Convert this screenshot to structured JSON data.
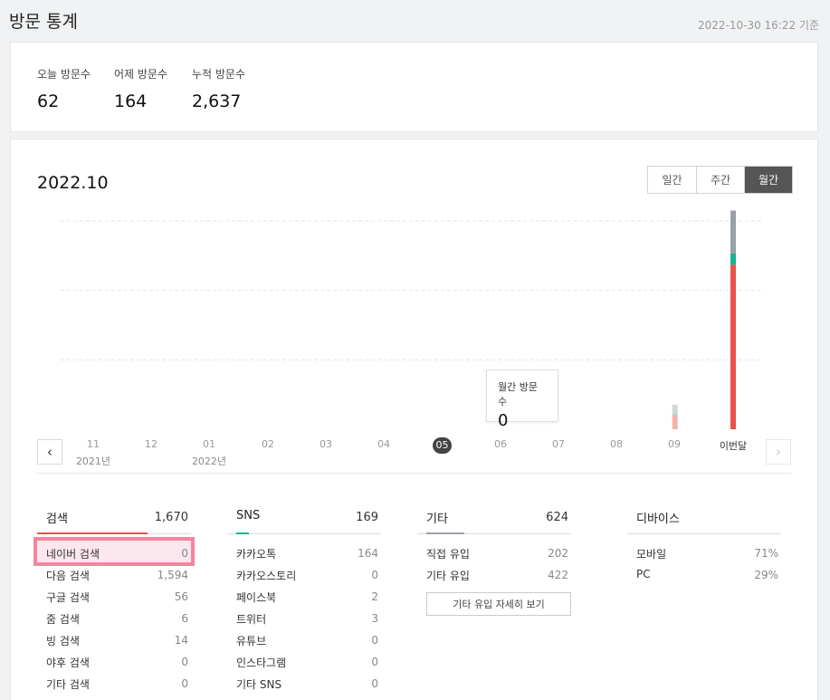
{
  "page": {
    "title": "방문 통계",
    "as_of": "2022-10-30 16:22 기준"
  },
  "summary": [
    {
      "label": "오늘 방문수",
      "value": "62"
    },
    {
      "label": "어제 방문수",
      "value": "164"
    },
    {
      "label": "누적 방문수",
      "value": "2,637"
    }
  ],
  "chart": {
    "period": "2022.10",
    "tabs": [
      "일간",
      "주간",
      "월간"
    ],
    "active_tab": "월간",
    "tooltip": {
      "label": "월간 방문수",
      "value": "0"
    },
    "months": [
      "11",
      "12",
      "01",
      "02",
      "03",
      "04",
      "05",
      "06",
      "07",
      "08",
      "09",
      "이번달"
    ],
    "years": [
      "2021년",
      "2022년"
    ],
    "selected_month": "05",
    "prev_icon": "chevron-left-icon",
    "next_icon": "chevron-right-icon"
  },
  "chart_data": {
    "type": "bar",
    "stacked": true,
    "categories": [
      "11",
      "12",
      "01",
      "02",
      "03",
      "04",
      "05",
      "06",
      "07",
      "08",
      "09",
      "이번달"
    ],
    "series": [
      {
        "values": [
          0,
          0,
          0,
          0,
          0,
          0,
          0,
          0,
          0,
          0,
          200,
          2370
        ],
        "color": "#e8534a"
      },
      {
        "values": [
          0,
          0,
          0,
          0,
          0,
          0,
          0,
          0,
          0,
          0,
          14,
          160
        ],
        "color": "#1ab394"
      },
      {
        "values": [
          0,
          0,
          0,
          0,
          0,
          0,
          0,
          0,
          0,
          0,
          140,
          620
        ],
        "color": "#9aa0a8"
      }
    ],
    "faded_categories": [
      "09"
    ],
    "ylim": [
      0,
      3000
    ],
    "grid": true,
    "legend": "none"
  },
  "stats": {
    "search": {
      "title": "검색",
      "total": "1,670",
      "items": [
        {
          "label": "네이버 검색",
          "value": "0"
        },
        {
          "label": "다음 검색",
          "value": "1,594"
        },
        {
          "label": "구글 검색",
          "value": "56"
        },
        {
          "label": "줌 검색",
          "value": "6"
        },
        {
          "label": "빙 검색",
          "value": "14"
        },
        {
          "label": "야후 검색",
          "value": "0"
        },
        {
          "label": "기타 검색",
          "value": "0"
        }
      ]
    },
    "sns": {
      "title": "SNS",
      "total": "169",
      "items": [
        {
          "label": "카카오톡",
          "value": "164"
        },
        {
          "label": "카카오스토리",
          "value": "0"
        },
        {
          "label": "페이스북",
          "value": "2"
        },
        {
          "label": "트위터",
          "value": "3"
        },
        {
          "label": "유튜브",
          "value": "0"
        },
        {
          "label": "인스타그램",
          "value": "0"
        },
        {
          "label": "기타 SNS",
          "value": "0"
        }
      ]
    },
    "other": {
      "title": "기타",
      "total": "624",
      "items": [
        {
          "label": "직접 유입",
          "value": "202"
        },
        {
          "label": "기타 유입",
          "value": "422"
        }
      ],
      "detail_button": "기타 유입 자세히 보기"
    },
    "device": {
      "title": "디바이스",
      "items": [
        {
          "label": "모바일",
          "value": "71%"
        },
        {
          "label": "PC",
          "value": "29%"
        }
      ]
    }
  },
  "colors": {
    "search_accent": "#e8534a",
    "sns_accent": "#1ab394",
    "other_accent": "#9aa0a8",
    "highlight_border": "#f0879f",
    "highlight_fill": "#fce7ee"
  }
}
